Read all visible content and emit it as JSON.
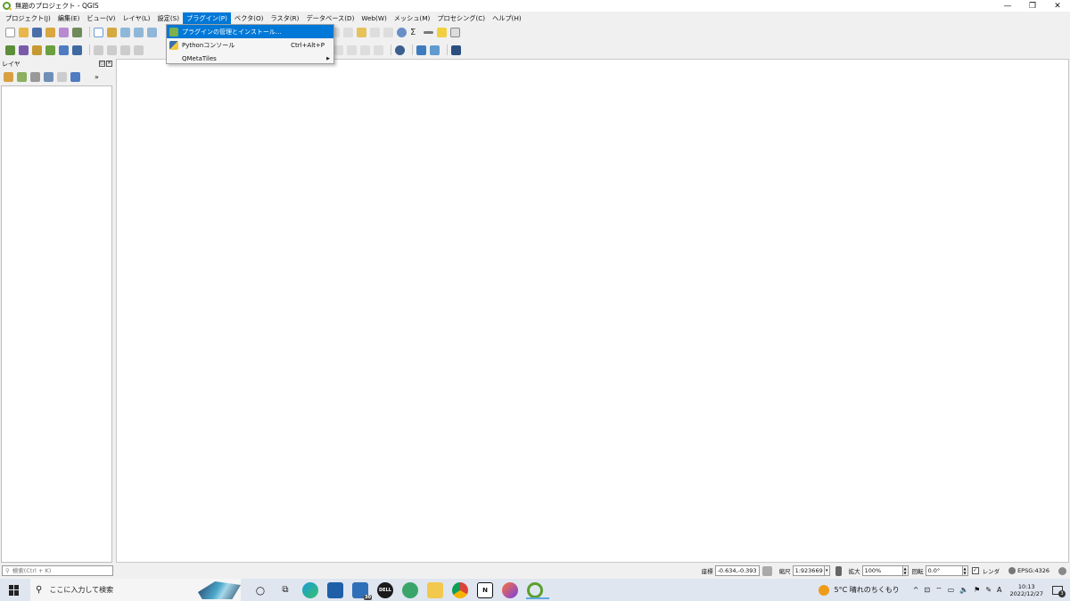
{
  "window": {
    "title": "無題のプロジェクト - QGIS",
    "min_glyph": "—",
    "restore_glyph": "❐",
    "close_glyph": "✕"
  },
  "menubar": [
    {
      "label": "プロジェクト(J)"
    },
    {
      "label": "編集(E)"
    },
    {
      "label": "ビュー(V)"
    },
    {
      "label": "レイヤ(L)"
    },
    {
      "label": "設定(S)"
    },
    {
      "label": "プラグイン(P)",
      "active": true
    },
    {
      "label": "ベクタ(O)"
    },
    {
      "label": "ラスタ(R)"
    },
    {
      "label": "データベース(D)"
    },
    {
      "label": "Web(W)"
    },
    {
      "label": "メッシュ(M)"
    },
    {
      "label": "プロセシング(C)"
    },
    {
      "label": "ヘルプ(H)"
    }
  ],
  "plugin_menu": {
    "items": [
      {
        "label": "プラグインの管理とインストール...",
        "icon": "plugin-puzzle-icon",
        "shortcut": ""
      },
      {
        "label": "Pythonコンソール",
        "icon": "python-icon",
        "shortcut": "Ctrl+Alt+P"
      },
      {
        "label": "QMetaTiles",
        "icon": "",
        "shortcut": "",
        "submenu_arrow": "▶"
      }
    ]
  },
  "layers_panel": {
    "title": "レイヤ",
    "more": "»",
    "float_glyph": "◰",
    "close_glyph": "✕"
  },
  "statusbar": {
    "search_placeholder": "検索(Ctrl + K)",
    "search_icon": "⚲",
    "coord_label": "座標",
    "coord_value": "-0.634,-0.393",
    "scale_label": "縮尺",
    "scale_value": "1:923669",
    "magnifier_label": "拡大",
    "magnifier_value": "100%",
    "rotation_label": "回転",
    "rotation_value": "0.0°",
    "render_label": "レンダ",
    "render_check": "✓",
    "crs": "EPSG:4326",
    "dropdown_arrow": "▾",
    "spin_up": "▲",
    "spin_down": "▼"
  },
  "taskbar": {
    "search_icon": "⚲",
    "search_placeholder": "ここに入力して検索",
    "cortana_glyph": "○",
    "taskview_glyph": "⧉",
    "mail_badge": "30",
    "dell_label": "DELL",
    "notion_label": "N",
    "weather": "5°C  晴れのちくもり",
    "tray_glyphs": [
      "^",
      "⊡",
      "⌔",
      "▭",
      "🔈",
      "⚑",
      "✎",
      "A"
    ],
    "time": "10:13",
    "date": "2022/12/27",
    "notifications": "3"
  }
}
